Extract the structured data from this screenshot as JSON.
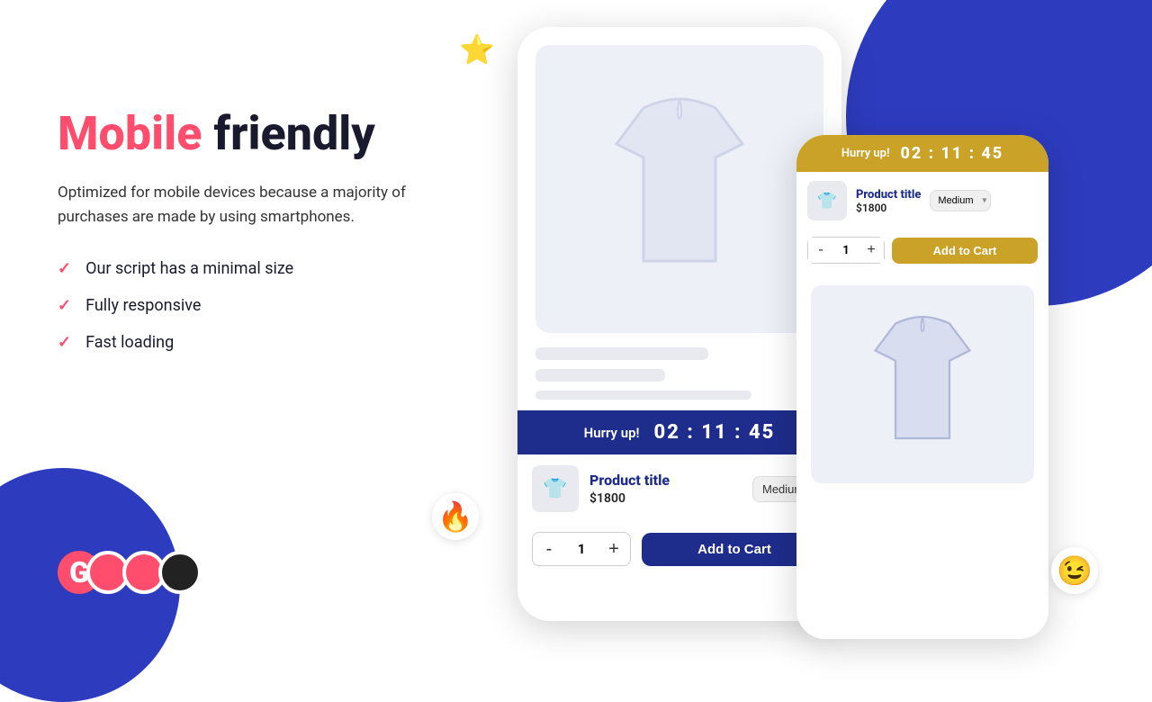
{
  "page": {
    "background_circle_top": "#2d3cbf",
    "background_circle_bottom": "#2d3cbf"
  },
  "headline": {
    "mobile": "Mobile",
    "friendly": " friendly"
  },
  "description": "Optimized for mobile devices because a majority of purchases are made by using smartphones.",
  "features": [
    {
      "text": "Our script has a minimal size"
    },
    {
      "text": "Fully responsive"
    },
    {
      "text": "Fast loading"
    }
  ],
  "logo": {
    "letter": "G"
  },
  "floats": {
    "star": "⭐",
    "fire": "🔥",
    "wink": "😉"
  },
  "phone_main": {
    "hurry_label": "Hurry up!",
    "timer": "02 : 11 : 45",
    "product_title": "Product title",
    "product_price": "$1800",
    "variant_value": "Medium",
    "quantity": "1",
    "add_to_cart": "Add to Cart",
    "qty_minus": "-",
    "qty_plus": "+"
  },
  "phone_second": {
    "hurry_label": "Hurry up!",
    "timer": "02 : 11 : 45",
    "product_title": "Product title",
    "product_price": "$1800",
    "variant_value": "Medium",
    "quantity": "1",
    "add_to_cart": "Add to Cart",
    "qty_minus": "-",
    "qty_plus": "+"
  }
}
